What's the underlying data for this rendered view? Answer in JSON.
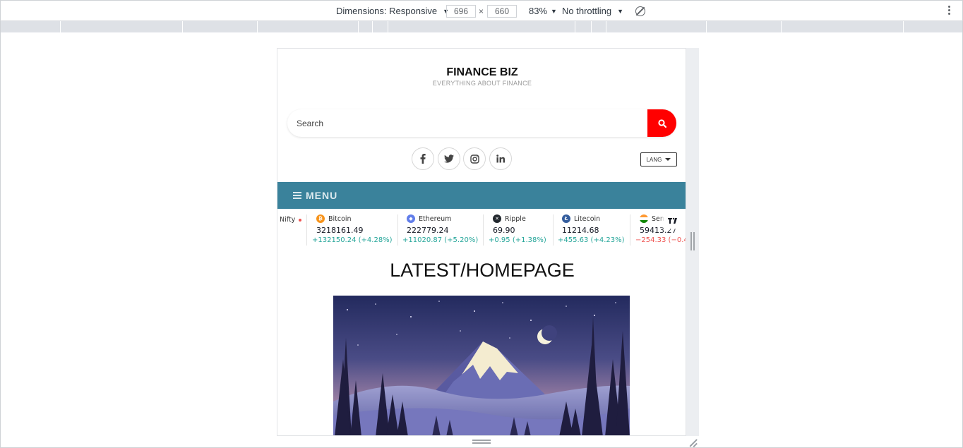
{
  "devtools": {
    "dimensions_label": "Dimensions: Responsive",
    "width_value": "696",
    "times_sign": "×",
    "height_value": "660",
    "zoom": "83%",
    "throttling": "No throttling"
  },
  "site": {
    "title": "FINANCE BIZ",
    "tagline": "EVERYTHING ABOUT FINANCE"
  },
  "search": {
    "placeholder": "Search"
  },
  "social": [
    {
      "glyph": "f"
    },
    {
      "glyph": "t"
    },
    {
      "glyph": "ig"
    },
    {
      "glyph": "in"
    }
  ],
  "lang": {
    "label": "LANG"
  },
  "menu": {
    "label": "MENU"
  },
  "ticker": [
    {
      "name": "Nifty",
      "price": "",
      "change": "",
      "dir": ""
    },
    {
      "name": "Bitcoin",
      "price": "3218161.49",
      "change": "+132150.24 (+4.28%)",
      "dir": "up",
      "color": "#f7931a"
    },
    {
      "name": "Ethereum",
      "price": "222779.24",
      "change": "+11020.87 (+5.20%)",
      "dir": "up",
      "color": "#627eea"
    },
    {
      "name": "Ripple",
      "price": "69.90",
      "change": "+0.95 (+1.38%)",
      "dir": "up",
      "color": "#23292f"
    },
    {
      "name": "Litecoin",
      "price": "11214.68",
      "change": "+455.63 (+4.23%)",
      "dir": "up",
      "color": "#345d9d"
    },
    {
      "name": "Sen",
      "price": "59413.27",
      "change": "−254.33 (−0.4",
      "dir": "down",
      "color": "#ff9933"
    }
  ],
  "main": {
    "heading": "LATEST/HOMEPAGE"
  }
}
